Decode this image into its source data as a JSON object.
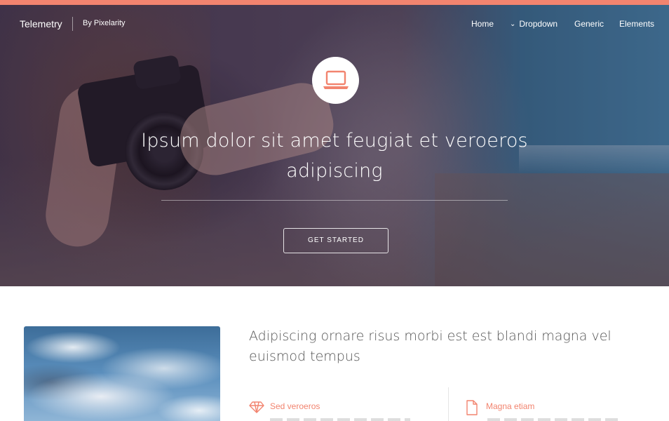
{
  "theme": {
    "accent": "#f2846f",
    "text": "#555555",
    "white": "#ffffff"
  },
  "nav": {
    "brand": "Telemetry",
    "byline": "By Pixelarity",
    "items": [
      {
        "label": "Home"
      },
      {
        "label": "Dropdown",
        "icon": "chevron-down-icon"
      },
      {
        "label": "Generic"
      },
      {
        "label": "Elements"
      }
    ]
  },
  "hero": {
    "icon": "laptop-icon",
    "title": "Ipsum dolor sit amet feugiat et veroeros adipiscing",
    "button": "GET STARTED"
  },
  "content": {
    "heading": "Adipiscing ornare risus morbi est est blandi magna vel euismod tempus",
    "features": [
      {
        "icon": "diamond-icon",
        "title": "Sed veroeros"
      },
      {
        "icon": "document-icon",
        "title": "Magna etiam"
      }
    ]
  }
}
